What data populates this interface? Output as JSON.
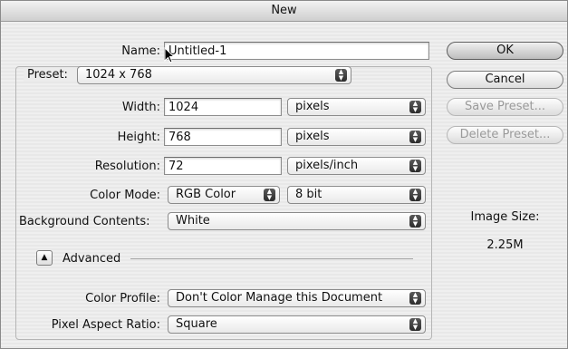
{
  "window": {
    "title": "New"
  },
  "name": {
    "label": "Name:",
    "value": "Untitled-1"
  },
  "preset": {
    "label": "Preset:",
    "value": "1024 x 768"
  },
  "width": {
    "label": "Width:",
    "value": "1024",
    "unit": "pixels"
  },
  "height": {
    "label": "Height:",
    "value": "768",
    "unit": "pixels"
  },
  "resolution": {
    "label": "Resolution:",
    "value": "72",
    "unit": "pixels/inch"
  },
  "color_mode": {
    "label": "Color Mode:",
    "value": "RGB Color",
    "depth": "8 bit"
  },
  "background": {
    "label": "Background Contents:",
    "value": "White"
  },
  "advanced": {
    "label": "Advanced"
  },
  "color_profile": {
    "label": "Color Profile:",
    "value": "Don't Color Manage this Document"
  },
  "pixel_aspect": {
    "label": "Pixel Aspect Ratio:",
    "value": "Square"
  },
  "buttons": {
    "ok": "OK",
    "cancel": "Cancel",
    "save_preset": "Save Preset...",
    "delete_preset": "Delete Preset..."
  },
  "image_size": {
    "label": "Image Size:",
    "value": "2.25M"
  }
}
